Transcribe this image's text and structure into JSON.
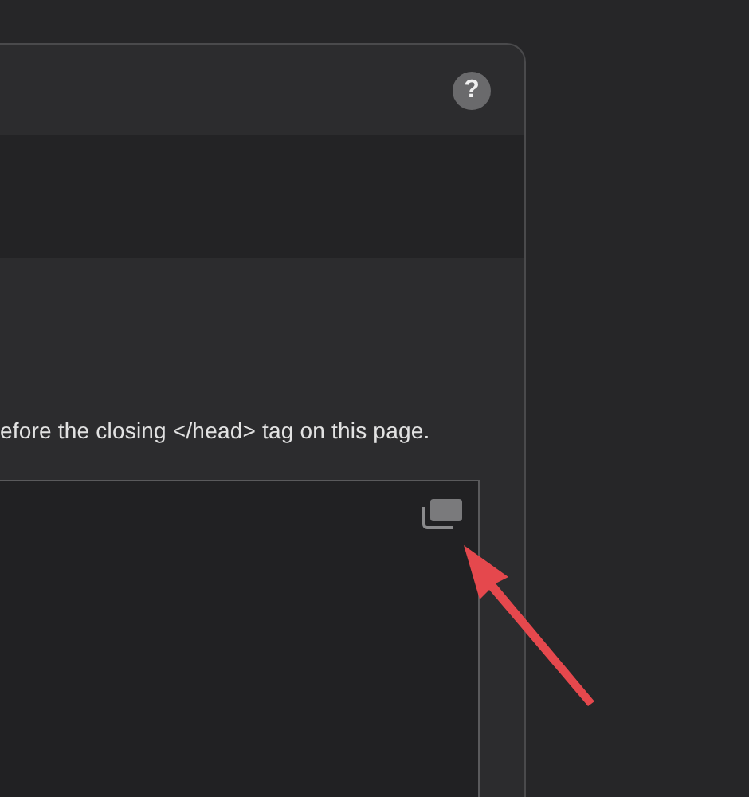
{
  "help_button": {
    "label": "?"
  },
  "instruction": "efore the closing </head> tag on this page."
}
